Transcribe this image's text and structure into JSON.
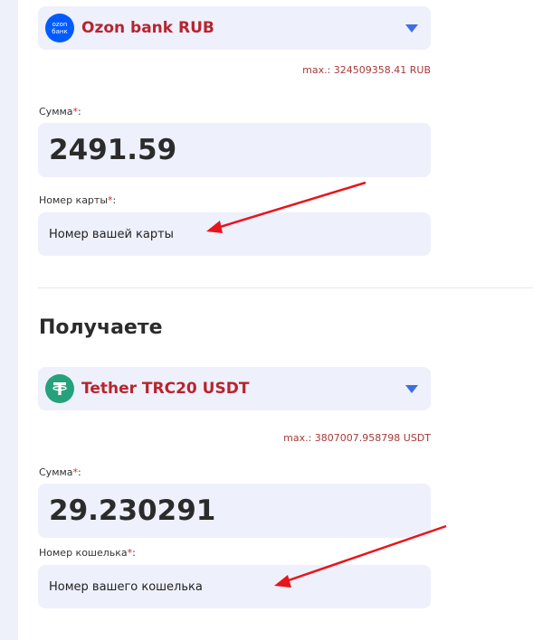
{
  "give": {
    "currency_logo_text": "ozon\nбанк",
    "currency_name": "Ozon bank RUB",
    "max_text": "max.: 324509358.41 RUB",
    "amount_label": "Сумма",
    "amount_value": "2491.59",
    "card_label": "Номер карты",
    "card_placeholder": "Номер вашей карты"
  },
  "receive": {
    "section_title": "Получаете",
    "currency_name": "Tether TRC20 USDT",
    "max_text": "max.: 3807007.958798 USDT",
    "amount_label": "Сумма",
    "amount_value": "29.230291",
    "wallet_label": "Номер кошелька",
    "wallet_placeholder": "Номер вашего кошелька"
  },
  "required_mark": "*",
  "label_colon": ":",
  "colors": {
    "accent_red": "#b6252f",
    "caret_blue": "#3d6fe0",
    "field_bg": "#eef0fb",
    "ozon_blue": "#005bff",
    "tether_green": "#26a17b",
    "annotation_arrow": "#e8141c"
  }
}
